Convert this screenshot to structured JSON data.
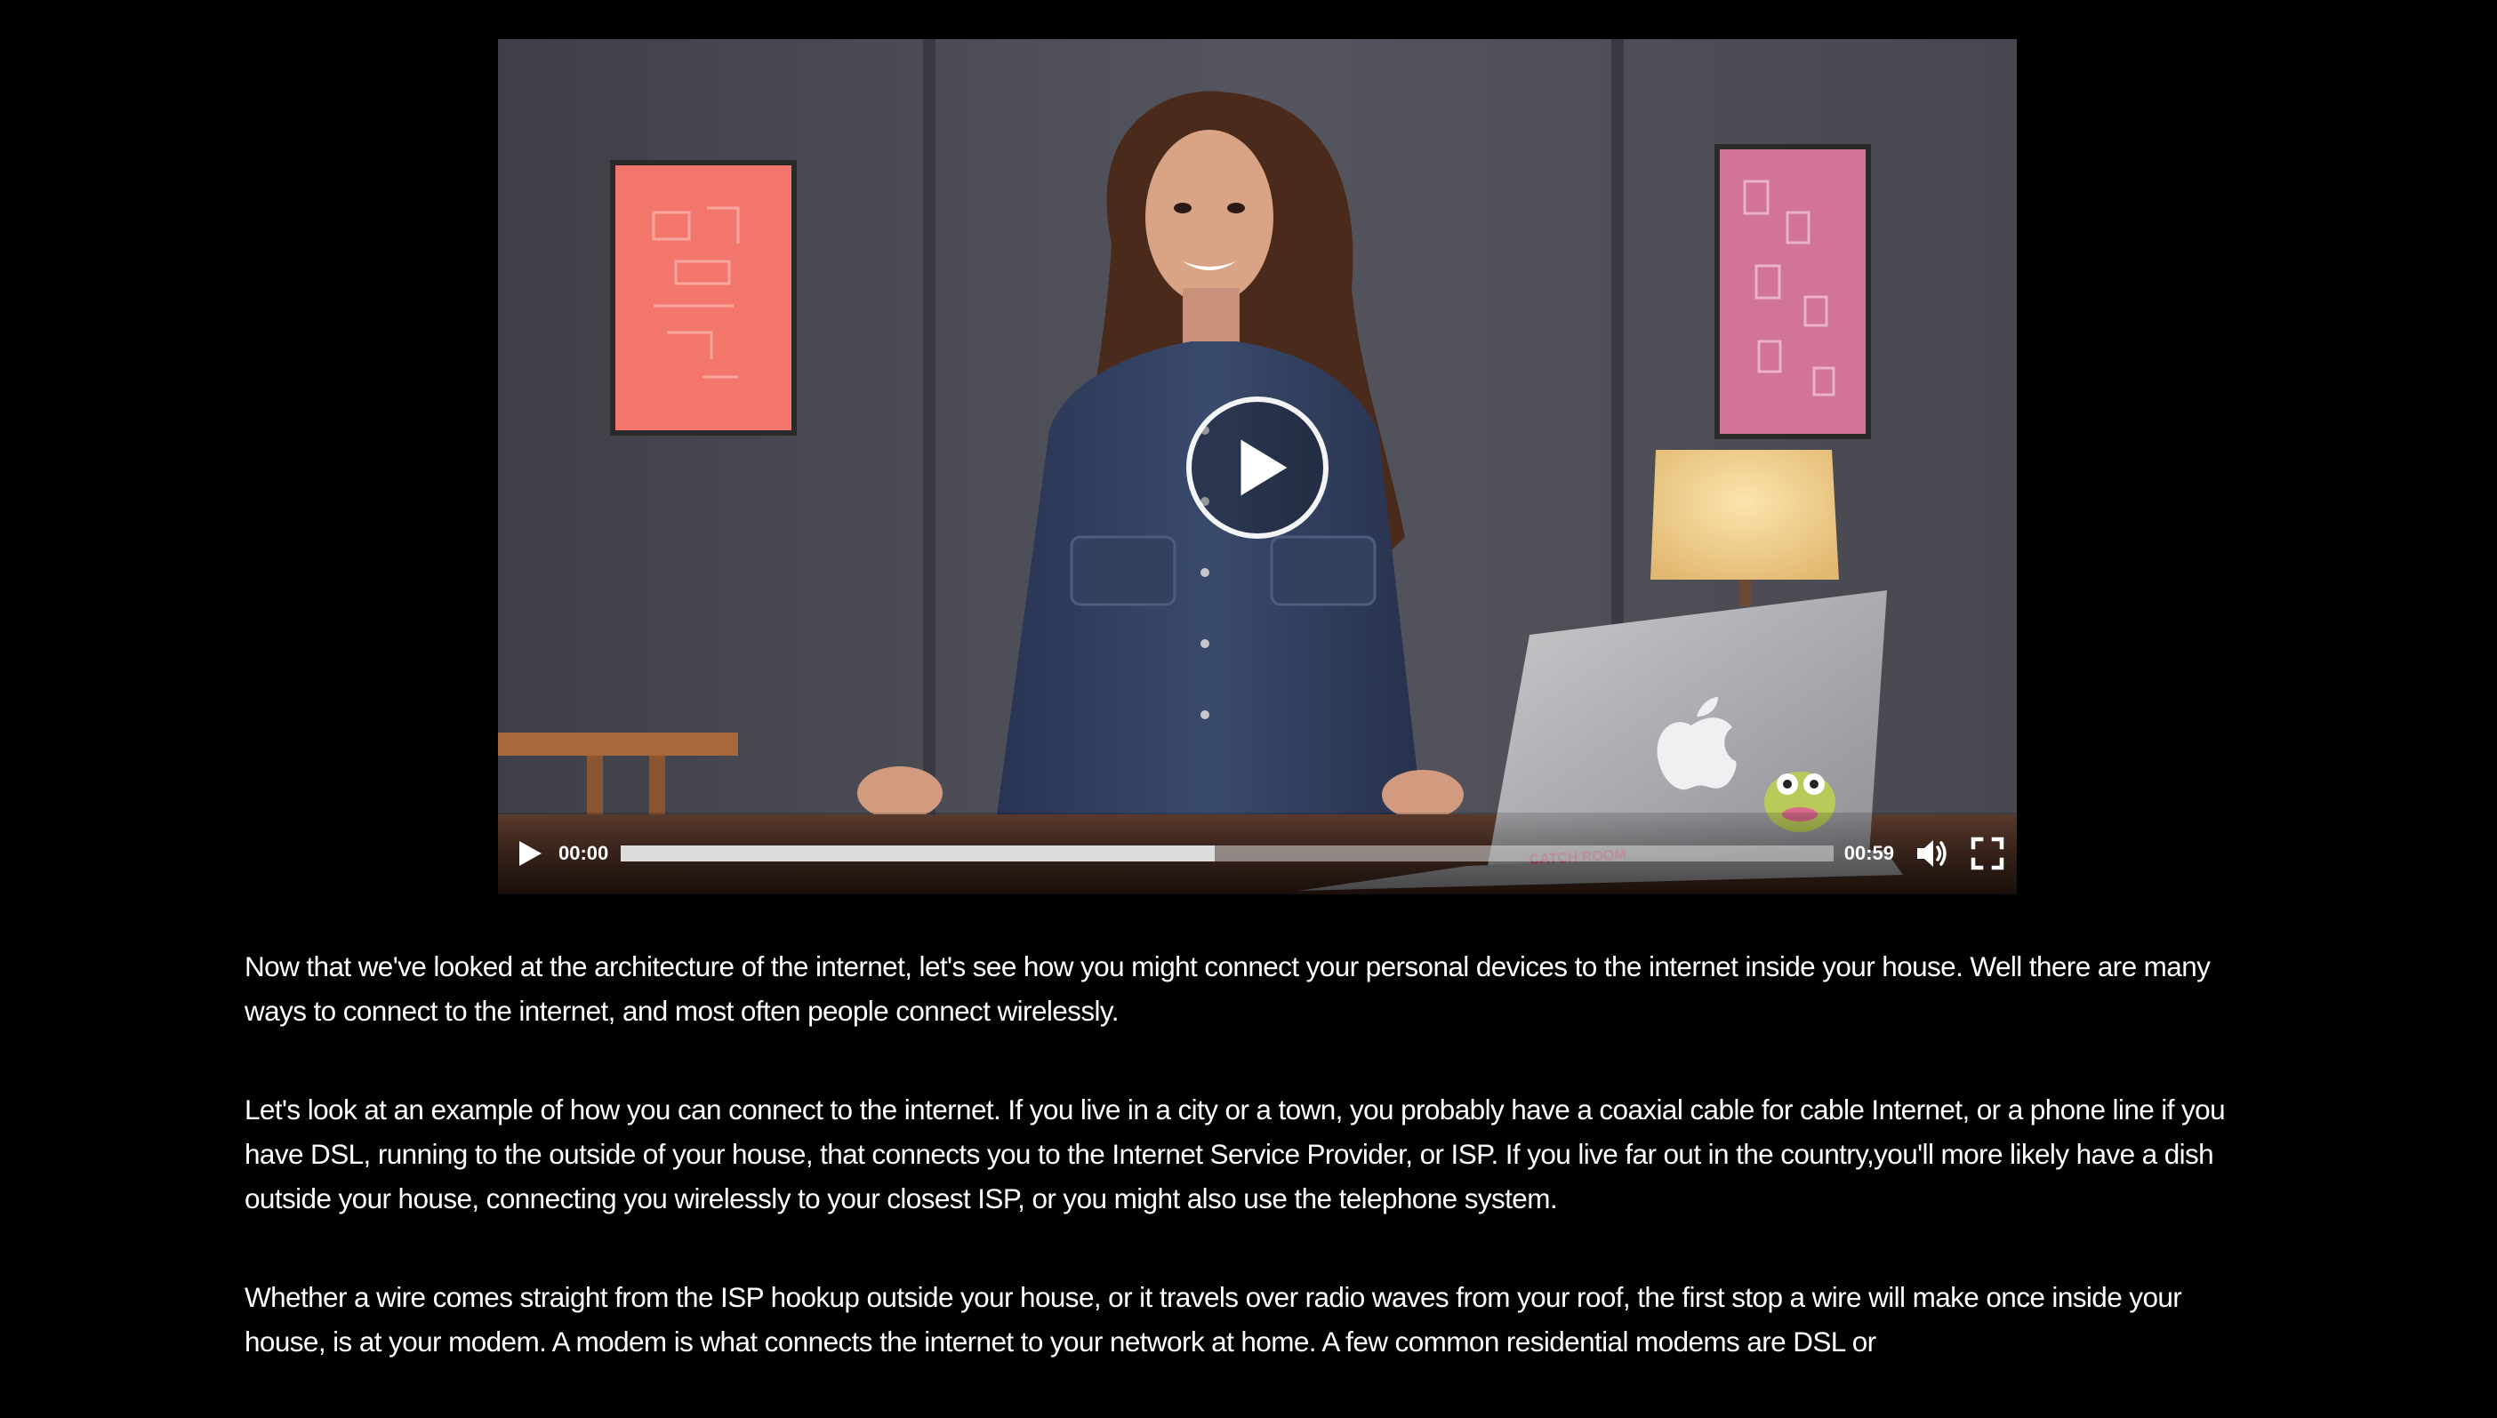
{
  "player": {
    "current_time": "00:00",
    "duration": "00:59",
    "buffered_fraction": 0.49,
    "played_fraction": 0.0,
    "sticker_text": "CATCH ROOM",
    "icons": {
      "big_play": "play-icon",
      "play": "play-icon",
      "volume": "volume-icon",
      "fullscreen": "fullscreen-icon"
    }
  },
  "transcript": {
    "paragraphs": [
      "Now that we've looked at the architecture of the internet, let's see how you might connect your personal devices to the internet inside your house. Well there are many ways to connect to the internet, and most often people connect wirelessly.",
      "Let's look at an example of how you can connect to the internet. If you live in a city or a town, you probably have a coaxial cable for cable Internet, or a phone line if you have DSL, running to the outside of your house, that connects you to the Internet Service Provider, or ISP. If you live far out in the country,you'll more likely have a dish outside your house, connecting you wirelessly to your closest ISP, or you might also use the telephone system.",
      "Whether a wire comes straight from the ISP hookup outside your house, or it travels over radio waves from your roof, the first stop a wire will make once inside your house, is at your modem. A modem is what connects the internet to your network at home. A few common residential modems are DSL or"
    ]
  },
  "colors": {
    "page_background": "#000000",
    "wall": "#4b4b54",
    "desk": "#5a3a2c",
    "poster_left": "#f2766c",
    "poster_right": "#d2739a",
    "lamp_shade": "#f2d08e",
    "laptop": "#b7b7bb",
    "shirt": "#2f3d5c",
    "text": "#ffffff"
  }
}
